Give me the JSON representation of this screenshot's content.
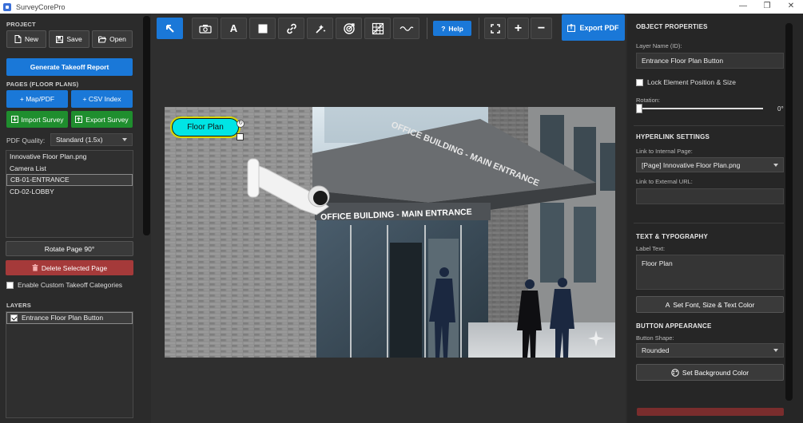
{
  "window": {
    "title": "SurveyCorePro",
    "controls": {
      "minimize": "—",
      "maximize": "❐",
      "close": "✕"
    }
  },
  "left": {
    "project_label": "PROJECT",
    "new_label": "New",
    "save_label": "Save",
    "open_label": "Open",
    "generate_report_label": "Generate Takeoff Report",
    "pages_label": "PAGES (FLOOR PLANS)",
    "map_pdf_label": "+ Map/PDF",
    "csv_index_label": "+ CSV Index",
    "import_survey_label": "Import Survey",
    "export_survey_label": "Export Survey",
    "pdf_quality_label": "PDF Quality:",
    "pdf_quality_value": "Standard (1.5x)",
    "pages": [
      {
        "label": "Innovative Floor Plan.png"
      },
      {
        "label": "Camera List"
      },
      {
        "label": "CB-01-ENTRANCE"
      },
      {
        "label": "CD-02-LOBBY"
      }
    ],
    "rotate_label": "Rotate Page 90°",
    "delete_label": "Delete Selected Page",
    "custom_categories_label": "Enable Custom Takeoff Categories",
    "layers_label": "LAYERS",
    "layers": [
      {
        "label": "Entrance Floor Plan Button"
      }
    ]
  },
  "toolbar": {
    "help_label": "Help",
    "export_pdf_label": "Export PDF"
  },
  "canvas": {
    "button_label": "Floor Plan",
    "sign_canopy": "OFFICE BUILDING - MAIN ENTRANCE",
    "sign_entrance": "OFFICE BUILDING - MAIN ENTRANCE"
  },
  "right": {
    "object_properties_label": "OBJECT PROPERTIES",
    "layer_name_label": "Layer Name (ID):",
    "layer_name_value": "Entrance Floor Plan Button",
    "lock_label": "Lock Element Position & Size",
    "rotation_label": "Rotation:",
    "rotation_value": "0°",
    "hyperlink_label": "HYPERLINK SETTINGS",
    "internal_link_label": "Link to Internal Page:",
    "internal_link_value": "[Page] Innovative Floor Plan.png",
    "external_url_label": "Link to External URL:",
    "external_url_value": "",
    "text_typo_label": "TEXT & TYPOGRAPHY",
    "label_text_label": "Label Text:",
    "label_text_value": "Floor Plan",
    "set_font_label": "Set Font, Size & Text Color",
    "button_appearance_label": "BUTTON APPEARANCE",
    "button_shape_label": "Button Shape:",
    "button_shape_value": "Rounded",
    "set_bg_label": "Set Background Color"
  },
  "colors": {
    "accent_blue": "#1a78d8",
    "green": "#1f8e2e",
    "red": "#a53a3a",
    "floor_plan_button": "#00e5e5"
  }
}
